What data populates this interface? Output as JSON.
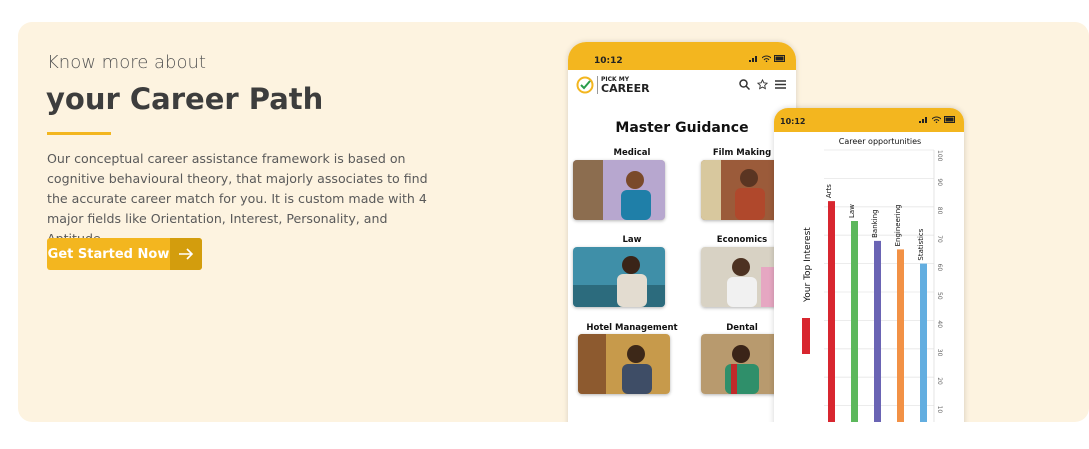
{
  "hero": {
    "eyebrow": "Know more about",
    "headline": "your Career Path",
    "description": "Our conceptual career assistance framework is based on cognitive behavioural theory, that majorly associates to find the accurate career match for you. It is custom made with 4 major fields like Orientation, Interest, Personality, and Aptitude.",
    "cta_label": "Get Started Now",
    "cta_icon": "arrow-right-icon"
  },
  "phone_main": {
    "time": "10:12",
    "logo_line1": "PICK MY",
    "logo_line2": "CAREER",
    "title": "Master Guidance",
    "categories": [
      "Medical",
      "Film Making",
      "Law",
      "Economics",
      "Hotel Management",
      "Dental"
    ]
  },
  "phone_chart": {
    "time": "10:12",
    "chart_data": {
      "type": "bar",
      "title": "Career opportunities",
      "ylabel": "Your Top Interest",
      "categories": [
        "Arts",
        "Law",
        "Banking",
        "Engineering",
        "Statistics"
      ],
      "values": [
        82,
        75,
        68,
        65,
        60
      ],
      "colors": [
        "#d8262f",
        "#5cb85c",
        "#6a64b4",
        "#f29145",
        "#63aee0"
      ],
      "ylim": [
        0,
        100
      ],
      "yticks": [
        0,
        10,
        20,
        30,
        40,
        50,
        60,
        70,
        80,
        90,
        100
      ]
    }
  }
}
